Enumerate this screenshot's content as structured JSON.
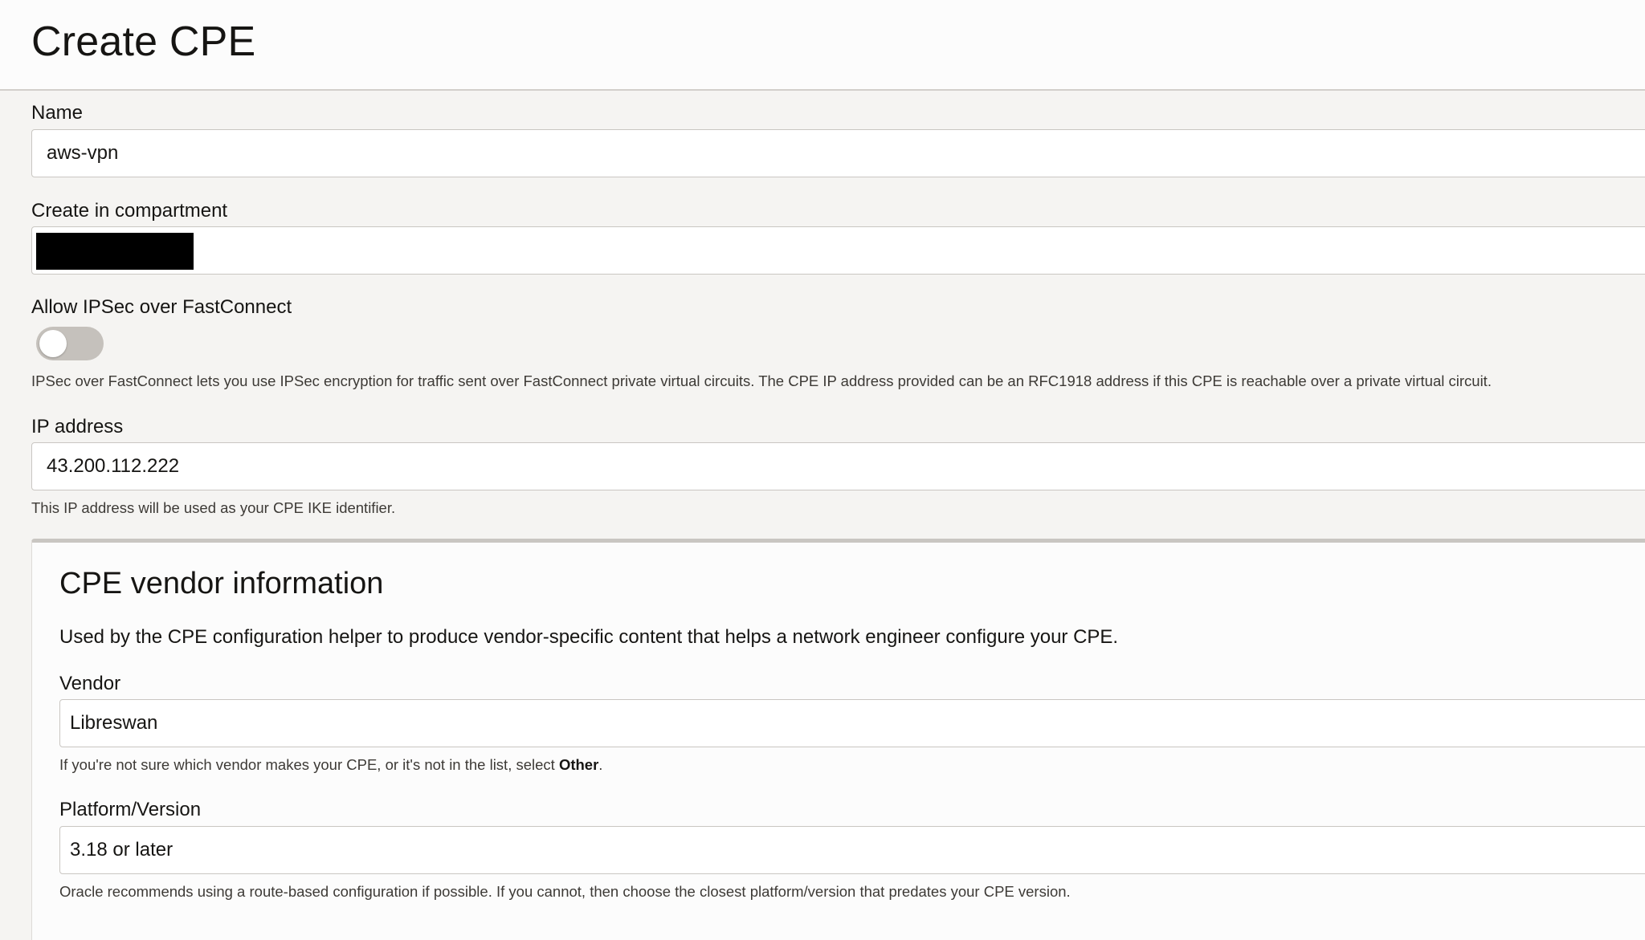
{
  "page": {
    "title": "Create CPE"
  },
  "form": {
    "name": {
      "label": "Name",
      "value": "aws-vpn"
    },
    "compartment": {
      "label": "Create in compartment",
      "value": ""
    },
    "ipsec_fastconnect": {
      "label": "Allow IPSec over FastConnect",
      "enabled": false,
      "help": "IPSec over FastConnect lets you use IPSec encryption for traffic sent over FastConnect private virtual circuits. The CPE IP address provided can be an RFC1918 address if this CPE is reachable over a private virtual circuit."
    },
    "ip_address": {
      "label": "IP address",
      "value": "43.200.112.222",
      "help": "This IP address will be used as your CPE IKE identifier."
    }
  },
  "vendor_panel": {
    "title": "CPE vendor information",
    "description": "Used by the CPE configuration helper to produce vendor-specific content that helps a network engineer configure your CPE.",
    "vendor": {
      "label": "Vendor",
      "value": "Libreswan",
      "help_prefix": "If you're not sure which vendor makes your CPE, or it's not in the list, select ",
      "help_bold": "Other",
      "help_suffix": "."
    },
    "platform": {
      "label": "Platform/Version",
      "value": "3.18 or later",
      "help": "Oracle recommends using a route-based configuration if possible. If you cannot, then choose the closest platform/version that predates your CPE version."
    }
  },
  "colors": {
    "page_background": "#f5f4f2",
    "toggle_off": "#c5c1bc",
    "redaction": "#000000"
  }
}
